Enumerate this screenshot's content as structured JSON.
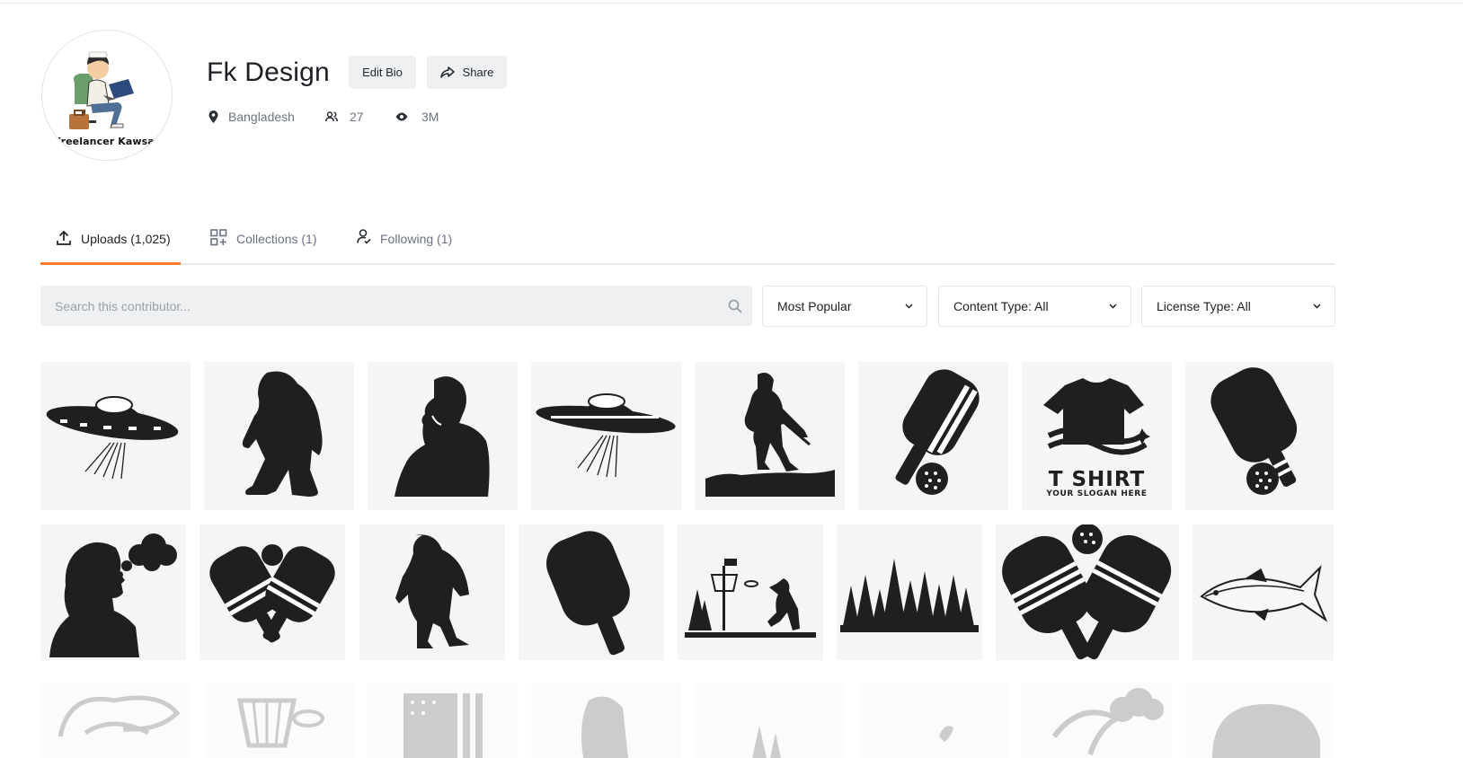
{
  "profile": {
    "name": "Fk Design",
    "avatar_caption": "Freelancer Kawsar",
    "location": "Bangladesh",
    "followers": "27",
    "views": "3M",
    "edit_bio_label": "Edit Bio",
    "share_label": "Share"
  },
  "tabs": [
    {
      "label": "Uploads (1,025)",
      "icon": "upload-icon",
      "active": true
    },
    {
      "label": "Collections (1)",
      "icon": "collections-icon",
      "active": false
    },
    {
      "label": "Following (1)",
      "icon": "following-icon",
      "active": false
    }
  ],
  "filters": {
    "search_placeholder": "Search this contributor...",
    "sort": "Most Popular",
    "content_type": "Content Type: All",
    "license_type": "License Type: All"
  },
  "thumbnails": {
    "row1": [
      "ufo",
      "bigfoot",
      "thinking-man",
      "ufo",
      "soldier",
      "pickleball-paddle",
      "t-shirt-logo",
      "pickleball-paddle"
    ],
    "row2": [
      "smoking-man",
      "crossed-paddles",
      "bigfoot",
      "paddle",
      "disc-golf",
      "pine-forest",
      "crossed-paddles",
      "tuna-fish"
    ],
    "row3": [
      "tuna-outline",
      "disc-golf-basket",
      "flag-gorilla",
      "gorilla",
      "forest",
      "bird",
      "horse-smoke",
      "hat"
    ],
    "tshirt_text": "T SHIRT",
    "tshirt_slogan": "YOUR SLOGAN HERE"
  },
  "colors": {
    "accent": "#ff7a2f",
    "button_bg": "#eef0f2",
    "thumb_bg": "#f4f5f7",
    "muted_text": "#6b7280"
  }
}
